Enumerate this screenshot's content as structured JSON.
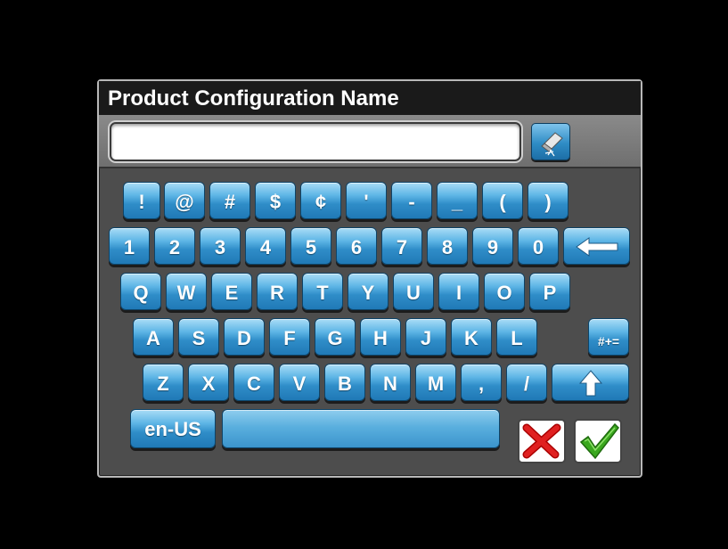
{
  "dialog": {
    "title": "Product Configuration Name",
    "input": {
      "value": ""
    }
  },
  "keys": {
    "row1": [
      "!",
      "@",
      "#",
      "$",
      "¢",
      "'",
      "-",
      "_",
      "(",
      ")"
    ],
    "row2": [
      "1",
      "2",
      "3",
      "4",
      "5",
      "6",
      "7",
      "8",
      "9",
      "0"
    ],
    "row3": [
      "Q",
      "W",
      "E",
      "R",
      "T",
      "Y",
      "U",
      "I",
      "O",
      "P"
    ],
    "row4": [
      "A",
      "S",
      "D",
      "F",
      "G",
      "H",
      "J",
      "K",
      "L"
    ],
    "row5": [
      "Z",
      "X",
      "C",
      "V",
      "B",
      "N",
      "M",
      ",",
      "/"
    ],
    "symbols_label": "#+=",
    "language_label": "en-US"
  },
  "icons": {
    "clear": "eraser-icon",
    "backspace": "left-arrow-icon",
    "shift": "up-arrow-icon",
    "cancel": "red-x-icon",
    "confirm": "green-check-icon"
  },
  "colors": {
    "key_blue": "#2f8dc8",
    "cancel_red": "#e02020",
    "confirm_green": "#3aa81e"
  }
}
